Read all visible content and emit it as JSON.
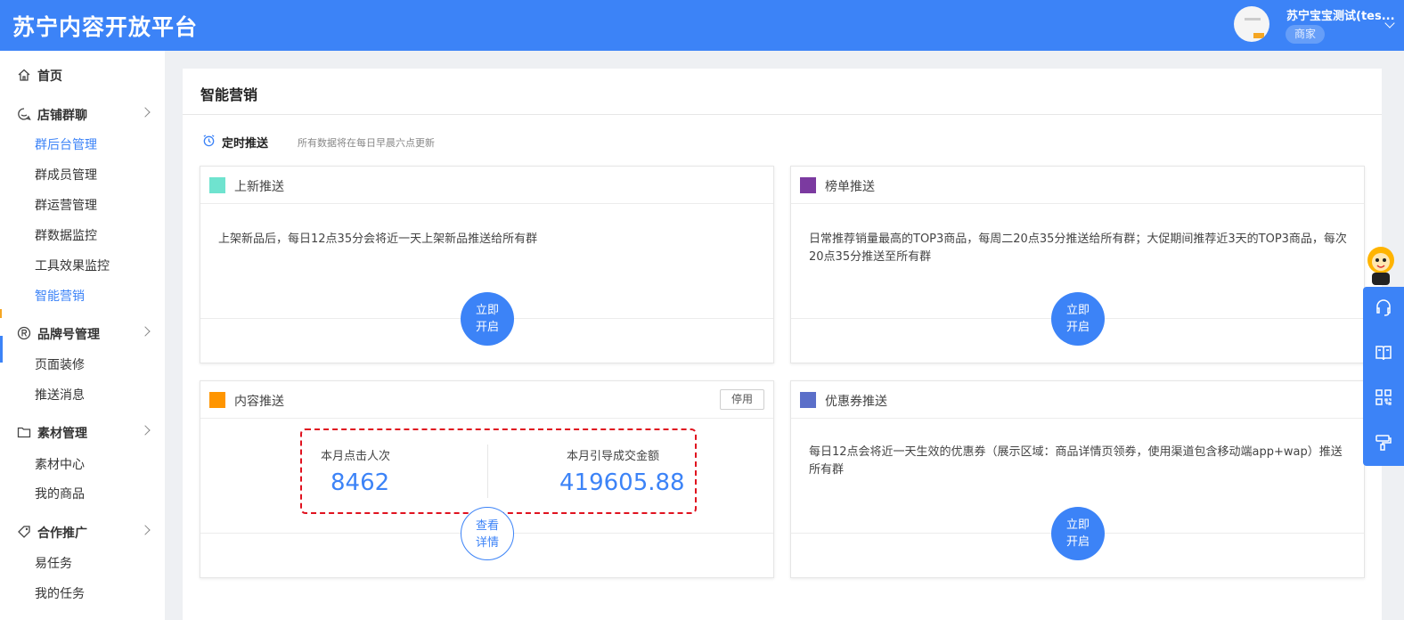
{
  "header": {
    "logo": "苏宁内容开放平台",
    "username": "苏宁宝宝测试(tes...",
    "role": "商家"
  },
  "sidebar": {
    "home": "首页",
    "groups": [
      {
        "label": "店铺群聊",
        "icon": "chat-icon",
        "items": [
          "群后台管理",
          "群成员管理",
          "群运营管理",
          "群数据监控",
          "工具效果监控",
          "智能营销"
        ]
      },
      {
        "label": "品牌号管理",
        "icon": "registered-icon",
        "items": [
          "页面装修",
          "推送消息"
        ]
      },
      {
        "label": "素材管理",
        "icon": "folder-icon",
        "items": [
          "素材中心",
          "我的商品"
        ]
      },
      {
        "label": "合作推广",
        "icon": "tag-icon",
        "items": [
          "易任务",
          "我的任务"
        ]
      }
    ]
  },
  "main": {
    "title": "智能营销",
    "schedule_title": "定时推送",
    "schedule_note": "所有数据将在每日早晨六点更新",
    "cards": {
      "new_push": {
        "title": "上新推送",
        "color": "#6fe3cf",
        "desc": "上架新品后，每日12点35分会将近一天上架新品推送给所有群",
        "button_line1": "立即",
        "button_line2": "开启"
      },
      "rank_push": {
        "title": "榜单推送",
        "color": "#7b3aa0",
        "desc": "日常推荐销量最高的TOP3商品，每周二20点35分推送给所有群；大促期间推荐近3天的TOP3商品，每次20点35分推送至所有群",
        "button_line1": "立即",
        "button_line2": "开启"
      },
      "content_push": {
        "title": "内容推送",
        "color": "#ff9500",
        "stop_label": "停用",
        "stat1_label": "本月点击人次",
        "stat1_value": "8462",
        "stat2_label": "本月引导成交金额",
        "stat2_value": "419605.88",
        "button_line1": "查看",
        "button_line2": "详情"
      },
      "coupon_push": {
        "title": "优惠券推送",
        "color": "#5b6fc9",
        "desc": "每日12点会将近一天生效的优惠券（展示区域：商品详情页领券，使用渠道包含移动端app+wap）推送所有群",
        "button_line1": "立即",
        "button_line2": "开启"
      }
    }
  },
  "float_toolbar": [
    "customer-service-icon",
    "book-icon",
    "qrcode-icon",
    "brush-icon"
  ],
  "colors": {
    "primary": "#3c83f7",
    "highlight": "#e0121f"
  }
}
